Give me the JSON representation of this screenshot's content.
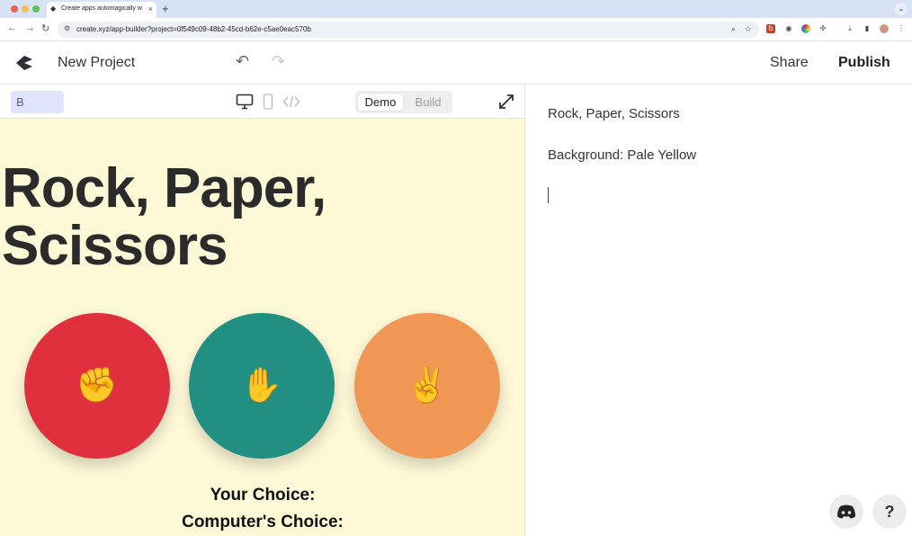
{
  "browser": {
    "tab_title": "Create apps automagically w",
    "tab_close": "×",
    "new_tab": "+",
    "tab_menu": "⌄",
    "url": "create.xyz/app-builder?project=0f549c09-48b2-45cd-b62e-c5ae0eac570b",
    "back": "←",
    "forward": "→",
    "reload": "↻"
  },
  "header": {
    "project_name": "New Project",
    "undo": "↶",
    "redo": "↷",
    "share_label": "Share",
    "publish_label": "Publish"
  },
  "toolbar": {
    "chip_label": "B",
    "demo_label": "Demo",
    "build_label": "Build",
    "selected_mode": "Demo"
  },
  "preview": {
    "title": "Rock, Paper, Scissors",
    "buttons": [
      {
        "label": "✊",
        "color": "#e0303e"
      },
      {
        "label": "✋",
        "color": "#218f82"
      },
      {
        "label": "✌️",
        "color": "#f09756"
      }
    ],
    "your_choice": "Your Choice:",
    "computer_choice": "Computer's Choice:",
    "background_color": "#fdf8d6"
  },
  "editor": {
    "lines": [
      "Rock, Paper, Scissors",
      "Background: Pale Yellow"
    ]
  },
  "fabs": {
    "help": "?"
  }
}
